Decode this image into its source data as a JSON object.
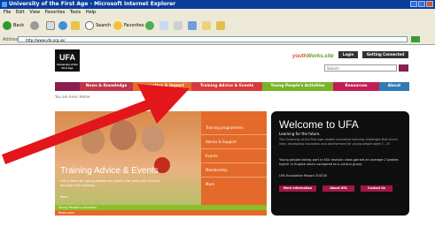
{
  "window": {
    "title": "University of the First Age - Microsoft Internet Explorer"
  },
  "menubar": {
    "items": [
      "File",
      "Edit",
      "View",
      "Favorites",
      "Tools",
      "Help"
    ]
  },
  "toolbar": {
    "back_label": "Back",
    "search_label": "Search",
    "favorites_label": "Favorites"
  },
  "addressbar": {
    "label": "Address",
    "url": "http://www.ufa.org.uk/"
  },
  "site": {
    "logo_text": "UFA",
    "logo_subtext": "University of the First Age",
    "brand_prefix": "youth",
    "brand_suffix": "Works.site",
    "login_label": "Login",
    "get_connected_label": "Getting Connected",
    "search_placeholder": "Search",
    "nav": [
      {
        "label": "",
        "color": "#8b1f4f"
      },
      {
        "label": "News & Knowledge",
        "color": "#c0364a"
      },
      {
        "label": "Innovation & Impact",
        "color": "#e06f2c"
      },
      {
        "label": "Training Advice & Events",
        "color": "#d83a3a"
      },
      {
        "label": "Young People's Activities",
        "color": "#78b42a"
      },
      {
        "label": "Resources",
        "color": "#c21e54"
      },
      {
        "label": "About",
        "color": "#2f7ab8"
      }
    ],
    "breadcrumb": "You are here: Home",
    "hero": {
      "title": "Training Advice & Events",
      "text": "UFA is there for young people and adults that work with them to develop their learning...",
      "link": "More"
    },
    "side_menu": [
      "Training programmes",
      "Advice & Support",
      "Events",
      "Membership",
      "More"
    ],
    "young_people_bar": "Young People's Activities",
    "resources_bar": "Resources",
    "welcome": {
      "title": "Welcome to UFA",
      "subtitle": "Learning for the future.",
      "text": "The University of the First Age creates innovative learning challenges that enrich lives, developing innovation and achievement for young people aged 5 - 25",
      "text2": "Young people taking part in KS4 revision class gained an average 2 grades higher in English when compared to a control group",
      "report": "UFA Evaluation Report 2007/8",
      "buttons": [
        "More information",
        "About UFA",
        "Contact Us"
      ]
    }
  }
}
